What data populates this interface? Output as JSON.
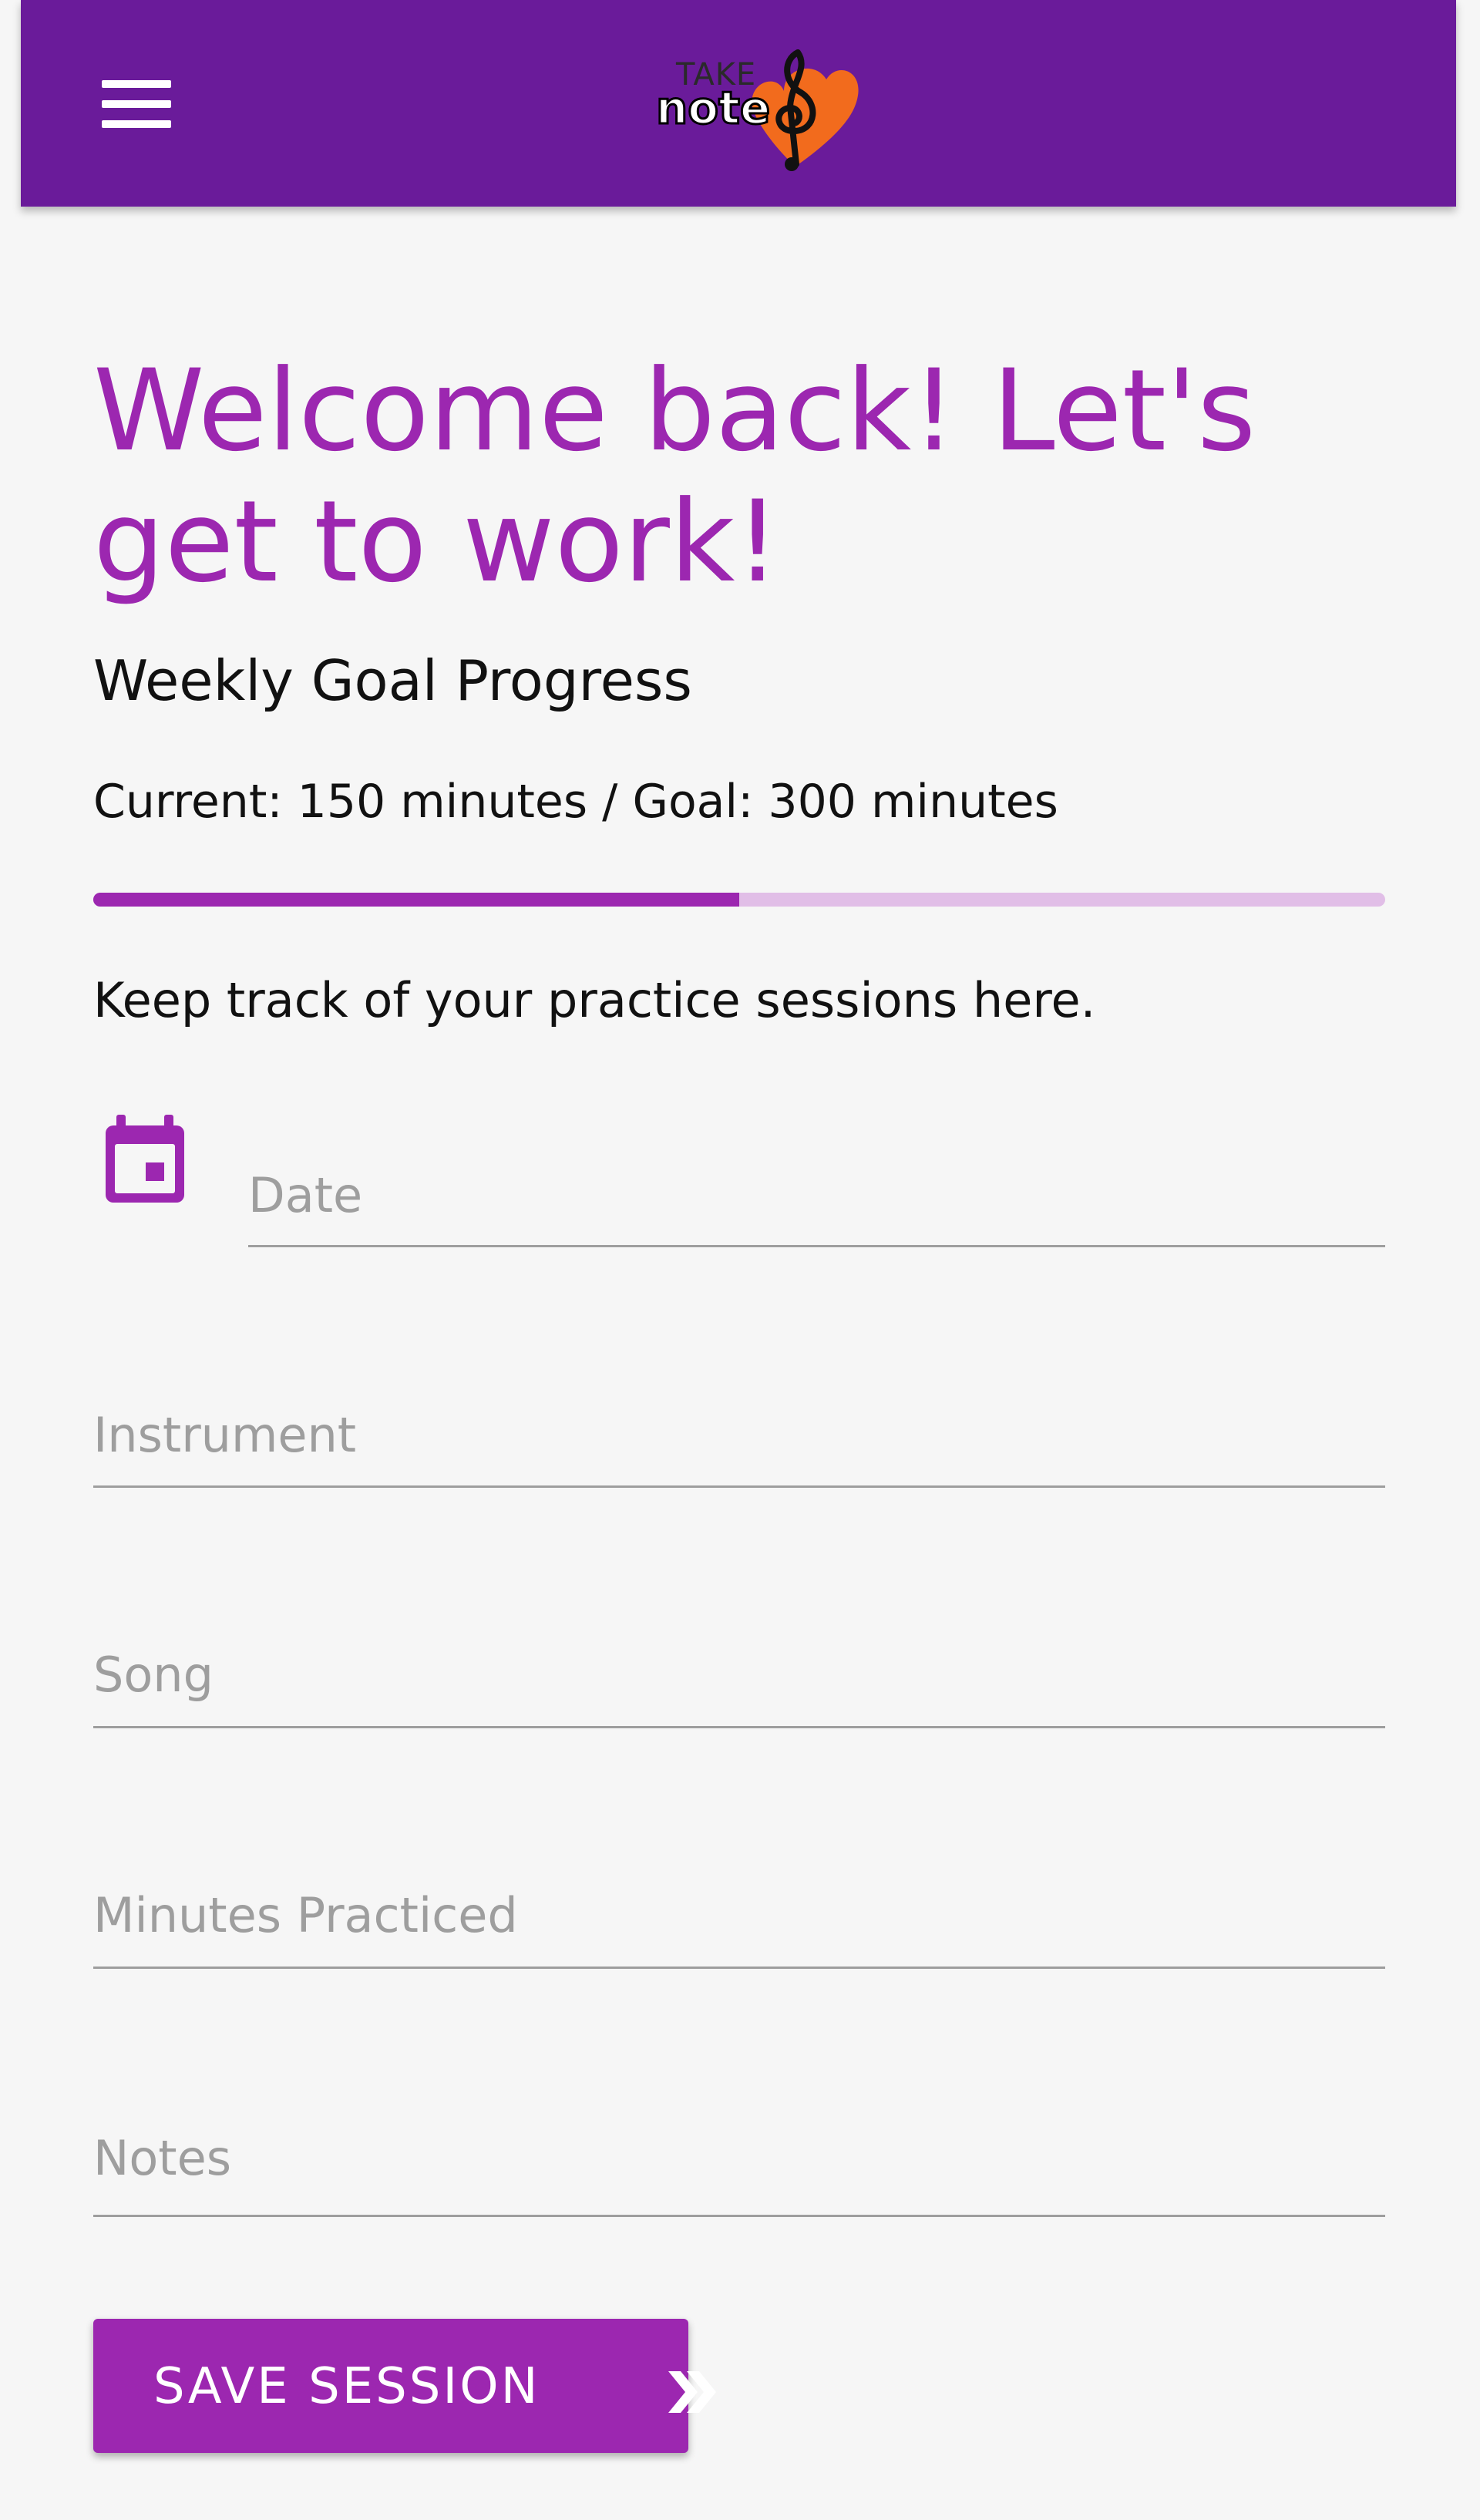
{
  "app": {
    "logo_text_top": "TAKE",
    "logo_text_main": "note",
    "menu_icon": "hamburger-menu-icon"
  },
  "header": {
    "title": "Welcome back! Let's get to work!",
    "weekly_goal_heading": "Weekly Goal Progress",
    "progress_text": "Current: 150 minutes / Goal: 300 minutes",
    "progress_fraction": 0.5,
    "helper_text": "Keep track of your practice sessions here."
  },
  "form": {
    "date_placeholder": "Date",
    "date_value": "",
    "date_icon": "calendar-icon",
    "instrument_placeholder": "Instrument",
    "instrument_value": "",
    "song_placeholder": "Song",
    "song_value": "",
    "minutes_placeholder": "Minutes Practiced",
    "minutes_value": "",
    "notes_placeholder": "Notes",
    "notes_value": "",
    "save_label": "SAVE SESSION",
    "save_icon": "double-chevron-right-icon"
  },
  "colors": {
    "appbar": "#6a1b9a",
    "accent": "#9c27b0",
    "progress_track": "#e1bee7",
    "logo_heart": "#f26b1d"
  }
}
